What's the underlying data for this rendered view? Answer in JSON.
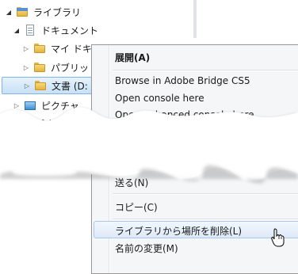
{
  "tree": {
    "items": [
      {
        "label": "ライブラリ"
      },
      {
        "label": "ドキュメント"
      },
      {
        "label": "マイ ドキ"
      },
      {
        "label": "パブリッ"
      },
      {
        "label": "文書 (D:"
      },
      {
        "label": "ピクチャ"
      },
      {
        "label": "デオ"
      }
    ]
  },
  "menu": {
    "items": [
      {
        "label": "展開(A)"
      },
      {
        "label": "Browse in Adobe Bridge CS5"
      },
      {
        "label": "Open console here"
      },
      {
        "label": "Open enhanced console here"
      },
      {
        "label": "送る(N)"
      },
      {
        "label": "コピー(C)"
      },
      {
        "label": "ライブラリから場所を削除(L)"
      },
      {
        "label": "名前の変更(M)"
      }
    ]
  }
}
